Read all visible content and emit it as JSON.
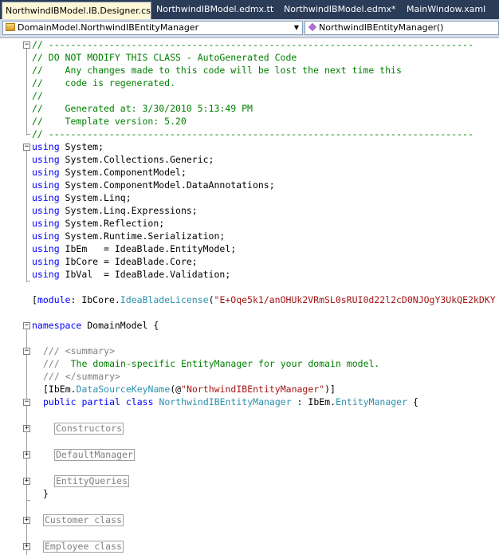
{
  "tabs": [
    {
      "label": "NorthwindIBModel.IB.Designer.cs",
      "active": true,
      "close": "×"
    },
    {
      "label": "NorthwindIBModel.edmx.tt",
      "active": false
    },
    {
      "label": "NorthwindIBModel.edmx*",
      "active": false
    },
    {
      "label": "MainWindow.xaml",
      "active": false
    }
  ],
  "navbar": {
    "type_combo": "DomainModel.NorthwindIBEntityManager",
    "member_combo": "NorthwindIBEntityManager()",
    "dropdown_glyph": "▼"
  },
  "code": {
    "header": [
      "// -----------------------------------------------------------------------------",
      "// DO NOT MODIFY THIS CLASS - AutoGenerated Code",
      "//    Any changes made to this code will be lost the next time this",
      "//    code is regenerated.",
      "//",
      "//    Generated at: 3/30/2010 5:13:49 PM",
      "//    Template version: 5.20",
      "// -----------------------------------------------------------------------------"
    ],
    "using_kw": "using",
    "usings": [
      " System;",
      " System.Collections.Generic;",
      " System.ComponentModel;",
      " System.ComponentModel.DataAnnotations;",
      " System.Linq;",
      " System.Linq.Expressions;",
      " System.Reflection;",
      " System.Runtime.Serialization;",
      " IbEm   = IdeaBlade.EntityModel;",
      " IbCore = IdeaBlade.Core;",
      " IbVal  = IdeaBlade.Validation;"
    ],
    "license": {
      "open": "[",
      "module_kw": "module",
      "colon": ": IbCore.",
      "type": "IdeaBladeLicense",
      "paren": "(",
      "value": "\"E+Oqe5k1/anOHUk2VRmSL0sRUI0d22l2cD0NJOgY3UkQE2kDKY"
    },
    "namespace_kw": "namespace",
    "namespace_name": " DomainModel {",
    "summary": {
      "slashes": "/// ",
      "open_tag": "<summary>",
      "text": " The domain-specific EntityManager for your domain model.",
      "close_tag": "</summary>"
    },
    "attribute": {
      "open": "[IbEm.",
      "name": "DataSourceKeyName",
      "args": "(@",
      "value": "\"NorthwindIBEntityManager\"",
      "close": ")]"
    },
    "class_decl": {
      "mod1": "public",
      "mod2": "partial",
      "mod3": "class",
      "name": "NorthwindIBEntityManager",
      "sep": " : IbEm.",
      "base": "EntityManager",
      "brace": " {"
    },
    "regions": [
      "Constructors",
      "DefaultManager",
      "EntityQueries"
    ],
    "class_close": "}",
    "outer_regions": [
      "Customer class",
      "Employee class"
    ]
  }
}
